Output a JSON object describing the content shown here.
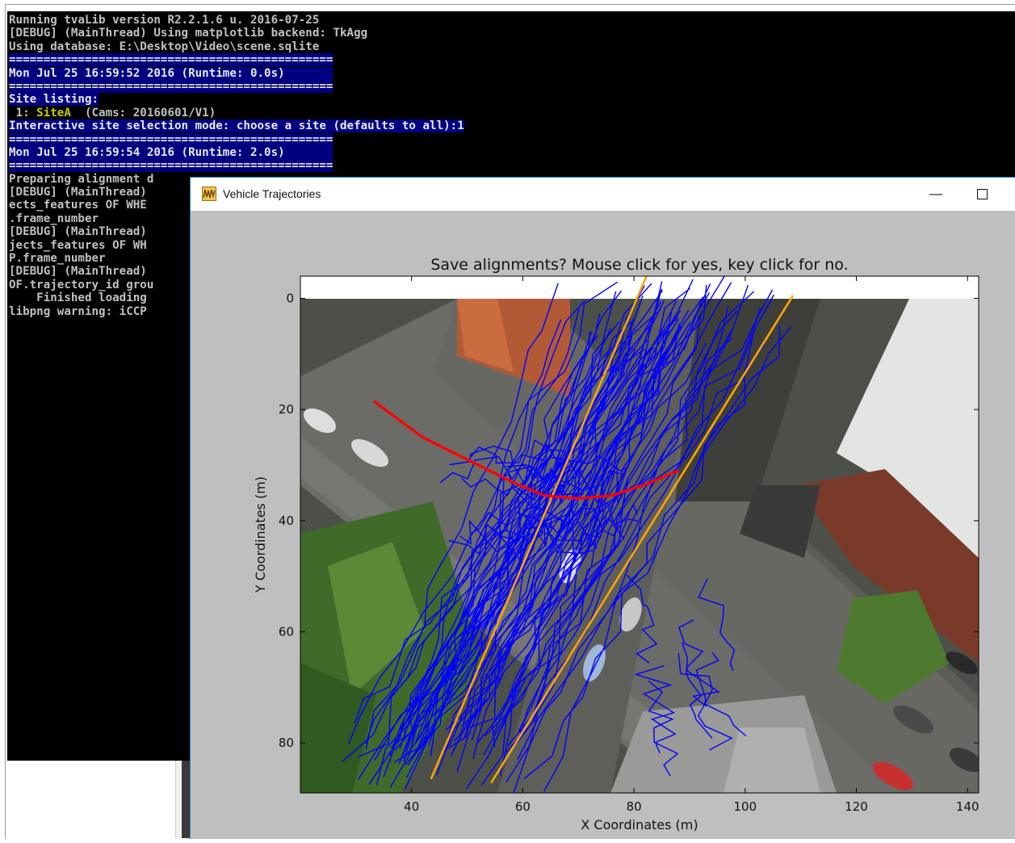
{
  "console": {
    "lines": [
      {
        "text": "Running tvaLib version R2.2.1.6 u. 2016-07-25",
        "hl": false
      },
      {
        "text": "[DEBUG] (MainThread) Using matplotlib backend: TkAgg",
        "hl": false
      },
      {
        "text": "Using database: E:\\Desktop\\Video\\scene.sqlite",
        "hl": false
      },
      {
        "text": "===============================================",
        "hl": true
      },
      {
        "text": "Mon Jul 25 16:59:52 2016 (Runtime: 0.0s)       ",
        "hl": true
      },
      {
        "text": "===============================================",
        "hl": true
      },
      {
        "text": "Site listing:",
        "hl": true
      },
      {
        "text": " 1: SiteA  (Cams: 20160601/V1)",
        "hl": false,
        "site": "SiteA"
      },
      {
        "text": "Interactive site selection mode: choose a site (defaults to all):1",
        "hl": true
      },
      {
        "text": "===============================================",
        "hl": true
      },
      {
        "text": "Mon Jul 25 16:59:54 2016 (Runtime: 2.0s)       ",
        "hl": true
      },
      {
        "text": "===============================================",
        "hl": true
      },
      {
        "text": "Preparing alignment d",
        "hl": false
      },
      {
        "text": "[DEBUG] (MainThread)",
        "hl": false
      },
      {
        "text": "ects_features OF WHE",
        "hl": false
      },
      {
        "text": ".frame_number",
        "hl": false
      },
      {
        "text": "[DEBUG] (MainThread)",
        "hl": false
      },
      {
        "text": "jects_features OF WH",
        "hl": false
      },
      {
        "text": "P.frame_number",
        "hl": false
      },
      {
        "text": "[DEBUG] (MainThread)",
        "hl": false
      },
      {
        "text": "OF.trajectory_id grou",
        "hl": false
      },
      {
        "text": "    Finished loading",
        "hl": false
      },
      {
        "text": "libpng warning: iCCP",
        "hl": false
      }
    ]
  },
  "figure_window": {
    "title": "Vehicle Trajectories",
    "minimize_glyph": "—",
    "icons": {
      "app": "matplotlib-icon",
      "minimize": "minimize-icon",
      "maximize": "maximize-icon"
    }
  },
  "chart_data": {
    "type": "line",
    "title": "Save alignments? Mouse click for yes, key click for no.",
    "xlabel": "X Coordinates (m)",
    "ylabel": "Y Coordinates (m)",
    "xlim": [
      20,
      142
    ],
    "ylim": [
      89,
      -4
    ],
    "xticks": [
      40,
      60,
      80,
      100,
      120,
      140
    ],
    "yticks": [
      0,
      20,
      40,
      60,
      80
    ],
    "background": "aerial photo of intersection",
    "colors": {
      "trajectories": "#0000ff",
      "alignment": "#ffa500",
      "red_alignment": "#ff0000"
    },
    "alignments": [
      {
        "color": "orange",
        "points": [
          [
            43.5,
            86.5
          ],
          [
            83.1,
            -6
          ]
        ]
      },
      {
        "color": "orange",
        "points": [
          [
            54.3,
            87.2
          ],
          [
            108.6,
            -0.5
          ]
        ]
      },
      {
        "color": "red",
        "points": [
          [
            33.2,
            18.5
          ],
          [
            42,
            25
          ],
          [
            50,
            29
          ],
          [
            58,
            33
          ],
          [
            64,
            35.5
          ],
          [
            70,
            36
          ],
          [
            76,
            35.5
          ],
          [
            82,
            33.5
          ],
          [
            88,
            31
          ]
        ]
      }
    ]
  }
}
